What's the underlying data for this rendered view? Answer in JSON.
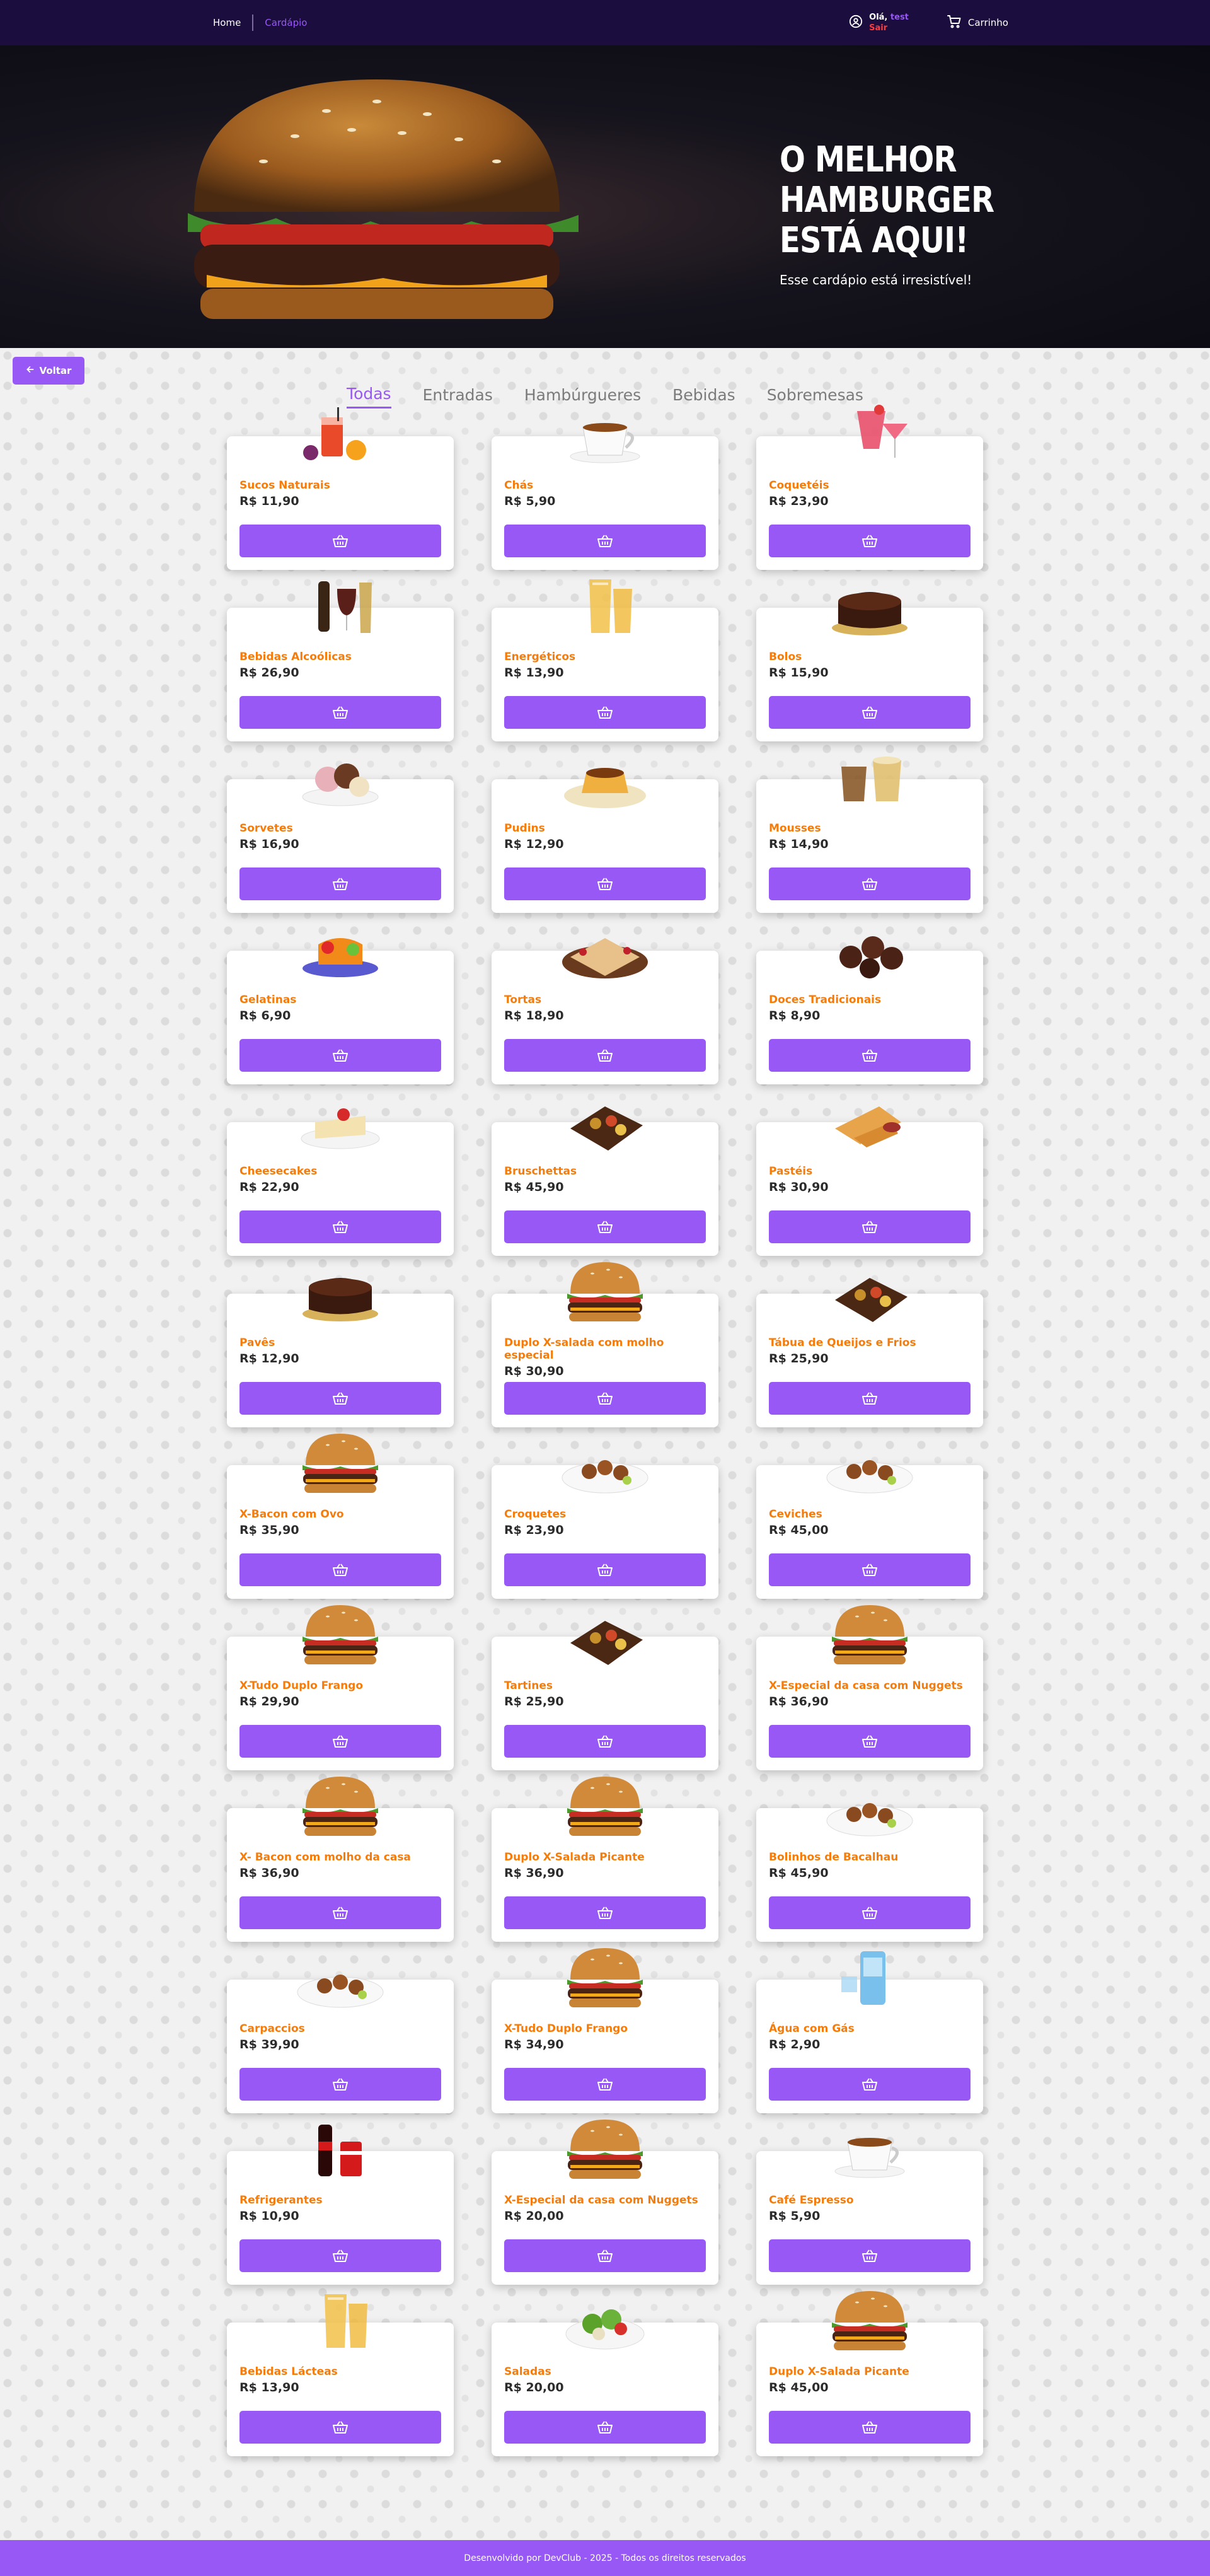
{
  "nav": {
    "home": "Home",
    "menu": "Cardápio",
    "greeting": "Olá,",
    "user_name": "test",
    "logout": "Sair",
    "cart": "Carrinho"
  },
  "hero": {
    "title": "O MELHOR\nHAMBURGER\nESTÁ AQUI!",
    "subtitle": "Esse cardápio está irresistível!"
  },
  "back_button": "Voltar",
  "tabs": [
    "Todas",
    "Entradas",
    "Hambúrgueres",
    "Bebidas",
    "Sobremesas"
  ],
  "active_tab": "Todas",
  "products": [
    {
      "name": "Sucos Naturais",
      "price": "R$ 11,90",
      "icon": "juice"
    },
    {
      "name": "Chás",
      "price": "R$ 5,90",
      "icon": "tea"
    },
    {
      "name": "Coquetéis",
      "price": "R$ 23,90",
      "icon": "cocktail"
    },
    {
      "name": "Bebidas Alcoólicas",
      "price": "R$ 26,90",
      "icon": "wine"
    },
    {
      "name": "Energéticos",
      "price": "R$ 13,90",
      "icon": "glass"
    },
    {
      "name": "Bolos",
      "price": "R$ 15,90",
      "icon": "cake"
    },
    {
      "name": "Sorvetes",
      "price": "R$ 16,90",
      "icon": "icecream"
    },
    {
      "name": "Pudins",
      "price": "R$ 12,90",
      "icon": "pudding"
    },
    {
      "name": "Mousses",
      "price": "R$ 14,90",
      "icon": "mousse"
    },
    {
      "name": "Gelatinas",
      "price": "R$ 6,90",
      "icon": "jelly"
    },
    {
      "name": "Tortas",
      "price": "R$ 18,90",
      "icon": "pie"
    },
    {
      "name": "Doces Tradicionais",
      "price": "R$ 8,90",
      "icon": "sweets"
    },
    {
      "name": "Cheesecakes",
      "price": "R$ 22,90",
      "icon": "cheesecake"
    },
    {
      "name": "Bruschettas",
      "price": "R$ 45,90",
      "icon": "board"
    },
    {
      "name": "Pastéis",
      "price": "R$ 30,90",
      "icon": "pastry"
    },
    {
      "name": "Pavês",
      "price": "R$ 12,90",
      "icon": "cake"
    },
    {
      "name": "Duplo X-salada com molho especial",
      "price": "R$ 30,90",
      "icon": "burger"
    },
    {
      "name": "Tábua de Queijos e Frios",
      "price": "R$ 25,90",
      "icon": "board"
    },
    {
      "name": "X-Bacon com Ovo",
      "price": "R$ 35,90",
      "icon": "burger"
    },
    {
      "name": "Croquetes",
      "price": "R$ 23,90",
      "icon": "plate"
    },
    {
      "name": "Ceviches",
      "price": "R$ 45,00",
      "icon": "plate"
    },
    {
      "name": "X-Tudo Duplo Frango",
      "price": "R$ 29,90",
      "icon": "burger"
    },
    {
      "name": "Tartines",
      "price": "R$ 25,90",
      "icon": "board"
    },
    {
      "name": "X-Especial da casa com Nuggets",
      "price": "R$ 36,90",
      "icon": "burger"
    },
    {
      "name": "X- Bacon com molho da casa",
      "price": "R$ 36,90",
      "icon": "burger"
    },
    {
      "name": "Duplo X-Salada Picante",
      "price": "R$ 36,90",
      "icon": "burger"
    },
    {
      "name": "Bolinhos de Bacalhau",
      "price": "R$ 45,90",
      "icon": "plate"
    },
    {
      "name": "Carpaccios",
      "price": "R$ 39,90",
      "icon": "plate"
    },
    {
      "name": "X-Tudo Duplo Frango",
      "price": "R$ 34,90",
      "icon": "burger"
    },
    {
      "name": "Água com Gás",
      "price": "R$ 2,90",
      "icon": "water"
    },
    {
      "name": "Refrigerantes",
      "price": "R$ 10,90",
      "icon": "soda"
    },
    {
      "name": "X-Especial da casa com Nuggets",
      "price": "R$ 20,00",
      "icon": "burger"
    },
    {
      "name": "Café Espresso",
      "price": "R$ 5,90",
      "icon": "tea"
    },
    {
      "name": "Bebidas Lácteas",
      "price": "R$ 13,90",
      "icon": "glass"
    },
    {
      "name": "Saladas",
      "price": "R$ 20,00",
      "icon": "salad"
    },
    {
      "name": "Duplo X-Salada Picante",
      "price": "R$ 45,00",
      "icon": "burger"
    }
  ],
  "footer": "Desenvolvido por DevClub - 2025 - Todos os direitos reservados",
  "colors": {
    "primary": "#9758f5",
    "nav_bg": "#1b0d3d",
    "product_name": "#f57c0b",
    "logout": "#ff3b3b"
  }
}
